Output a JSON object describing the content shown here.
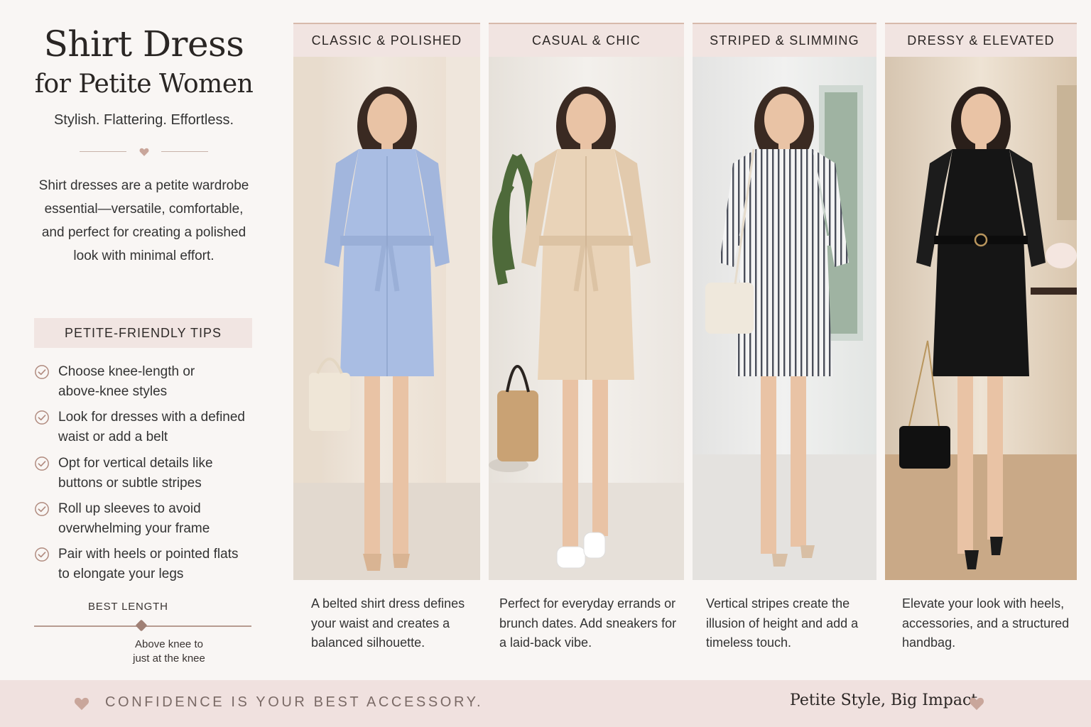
{
  "header": {
    "title_line1": "Shirt Dress",
    "title_line2": "for Petite Women",
    "tagline": "Stylish. Flattering. Effortless.",
    "intro": "Shirt dresses are a petite wardrobe essential—versatile, comfortable, and perfect for creating a polished look with minimal effort."
  },
  "tips": {
    "heading": "PETITE-FRIENDLY TIPS",
    "items": [
      {
        "line1": "Choose knee-length or",
        "line2": "above-knee styles"
      },
      {
        "line1": "Look for dresses with a defined",
        "line2": "waist or add a belt"
      },
      {
        "line1": "Opt for vertical details like",
        "line2": "buttons or subtle stripes"
      },
      {
        "line1": "Roll up sleeves to avoid",
        "line2": "overwhelming your frame"
      },
      {
        "line1": "Pair with heels or pointed flats",
        "line2": "to elongate your legs"
      }
    ]
  },
  "best_length": {
    "label": "BEST LENGTH",
    "line1": "Above knee to",
    "line2": "just at the knee"
  },
  "looks": [
    {
      "heading": "CLASSIC & POLISHED",
      "description": "A belted shirt dress defines your waist and creates a balanced silhouette.",
      "dress_color": "#a9bde3",
      "background": "#ece3d8"
    },
    {
      "heading": "CASUAL & CHIC",
      "description": "Perfect for everyday errands or brunch dates. Add sneakers for a laid-back vibe.",
      "dress_color": "#e9d3b8",
      "background": "#ece7e1"
    },
    {
      "heading": "STRIPED & SLIMMING",
      "description": "Vertical stripes create the illusion of height and add a timeless touch.",
      "dress_color": "#f2f2f2",
      "background": "#e7e7e6"
    },
    {
      "heading": "DRESSY & ELEVATED",
      "description": "Elevate your look with heels, accessories, and a structured handbag.",
      "dress_color": "#151515",
      "background": "#d9c3a8"
    }
  ],
  "footer": {
    "slogan": "CONFIDENCE IS YOUR BEST ACCESSORY.",
    "brand": "Petite Style, Big Impact."
  },
  "colors": {
    "accent": "#b89386",
    "tip_band": "#f1e5e2",
    "footer_band": "#f0e1df"
  },
  "icons": [
    "heart-icon",
    "check-circle-icon"
  ]
}
